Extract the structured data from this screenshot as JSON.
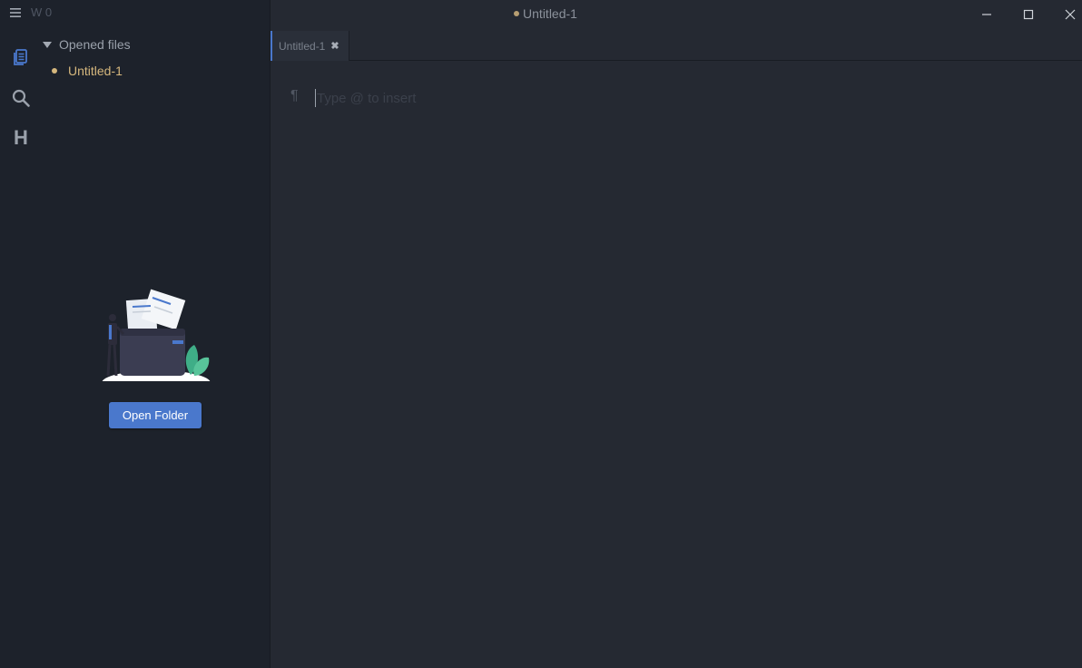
{
  "app": {
    "title": "Untitled-1",
    "title_unsaved": true,
    "word_count_label": "W 0"
  },
  "activity_bar": {
    "items": [
      {
        "icon": "files-icon",
        "active": true
      },
      {
        "icon": "search-icon",
        "active": false
      },
      {
        "icon": "heading-outline-icon",
        "active": false
      }
    ],
    "heading_glyph": "H"
  },
  "sidebar": {
    "section_label": "Opened files",
    "files": [
      {
        "name": "Untitled-1",
        "unsaved": true
      }
    ],
    "open_folder_label": "Open Folder"
  },
  "tabs": [
    {
      "label": "Untitled-1",
      "close_glyph": "✖",
      "active": true
    }
  ],
  "editor": {
    "paragraph_glyph": "¶",
    "placeholder": "Type @ to insert",
    "value": ""
  },
  "colors": {
    "accent": "#4a78cc",
    "unsaved": "#d5b77d",
    "sidebar_bg": "#1d222b",
    "editor_bg": "#252932"
  }
}
